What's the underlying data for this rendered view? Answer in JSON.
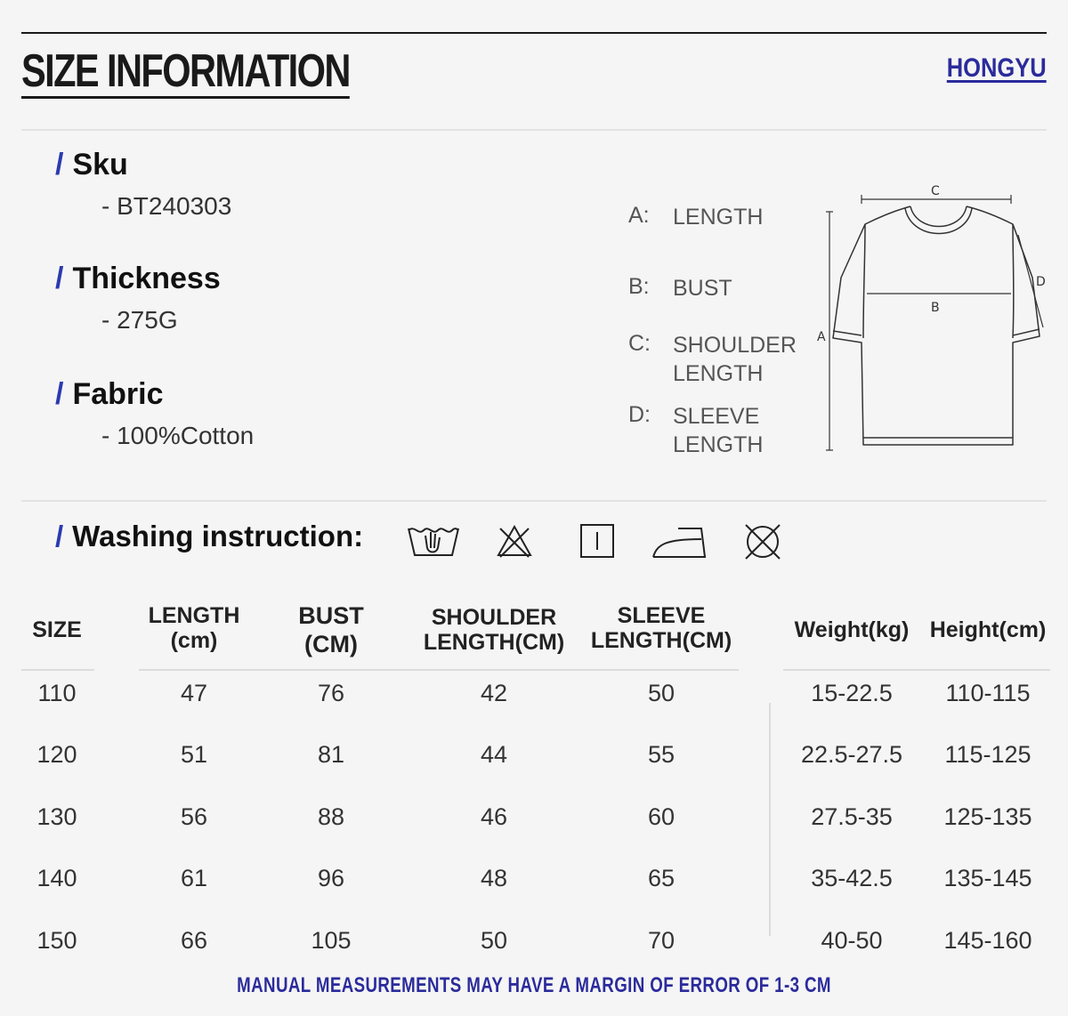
{
  "header": {
    "title": "SIZE INFORMATION",
    "brand": "HONGYU"
  },
  "specs": [
    {
      "label": "Sku",
      "value": "- BT240303"
    },
    {
      "label": "Thickness",
      "value": "- 275G"
    },
    {
      "label": "Fabric",
      "value": "- 100%Cotton"
    }
  ],
  "legend": [
    {
      "key": "A:",
      "line1": "LENGTH",
      "line2": ""
    },
    {
      "key": "B:",
      "line1": "BUST",
      "line2": ""
    },
    {
      "key": "C:",
      "line1": "SHOULDER",
      "line2": "LENGTH"
    },
    {
      "key": "D:",
      "line1": "SLEEVE",
      "line2": "LENGTH"
    }
  ],
  "diagram": {
    "label_a": "A",
    "label_b": "B",
    "label_c": "C",
    "label_d": "D"
  },
  "washing": {
    "label": "Washing instruction:",
    "icons": [
      "hand-wash-icon",
      "no-bleach-icon",
      "line-dry-icon",
      "iron-icon",
      "no-tumble-dry-icon"
    ]
  },
  "table": {
    "headers": {
      "size": "SIZE",
      "length_1": "LENGTH",
      "length_2": "(cm)",
      "bust_1": "BUST",
      "bust_2": "(CM)",
      "shoulder_1": "SHOULDER",
      "shoulder_2": "LENGTH(CM)",
      "sleeve_1": "SLEEVE",
      "sleeve_2": "LENGTH(CM)",
      "weight": "Weight(kg)",
      "height": "Height(cm)"
    },
    "rows": [
      {
        "size": "110",
        "length": "47",
        "bust": "76",
        "shoulder": "42",
        "sleeve": "50",
        "weight": "15-22.5",
        "height": "110-115"
      },
      {
        "size": "120",
        "length": "51",
        "bust": "81",
        "shoulder": "44",
        "sleeve": "55",
        "weight": "22.5-27.5",
        "height": "115-125"
      },
      {
        "size": "130",
        "length": "56",
        "bust": "88",
        "shoulder": "46",
        "sleeve": "60",
        "weight": "27.5-35",
        "height": "125-135"
      },
      {
        "size": "140",
        "length": "61",
        "bust": "96",
        "shoulder": "48",
        "sleeve": "65",
        "weight": "35-42.5",
        "height": "135-145"
      },
      {
        "size": "150",
        "length": "66",
        "bust": "105",
        "shoulder": "50",
        "sleeve": "70",
        "weight": "40-50",
        "height": "145-160"
      }
    ]
  },
  "footer": {
    "note": "MANUAL MEASUREMENTS MAY HAVE A MARGIN OF ERROR OF 1-3 CM"
  },
  "colors": {
    "accent": "#2b3ab0",
    "brand": "#2b2b9c",
    "background": "#f5f5f5"
  }
}
